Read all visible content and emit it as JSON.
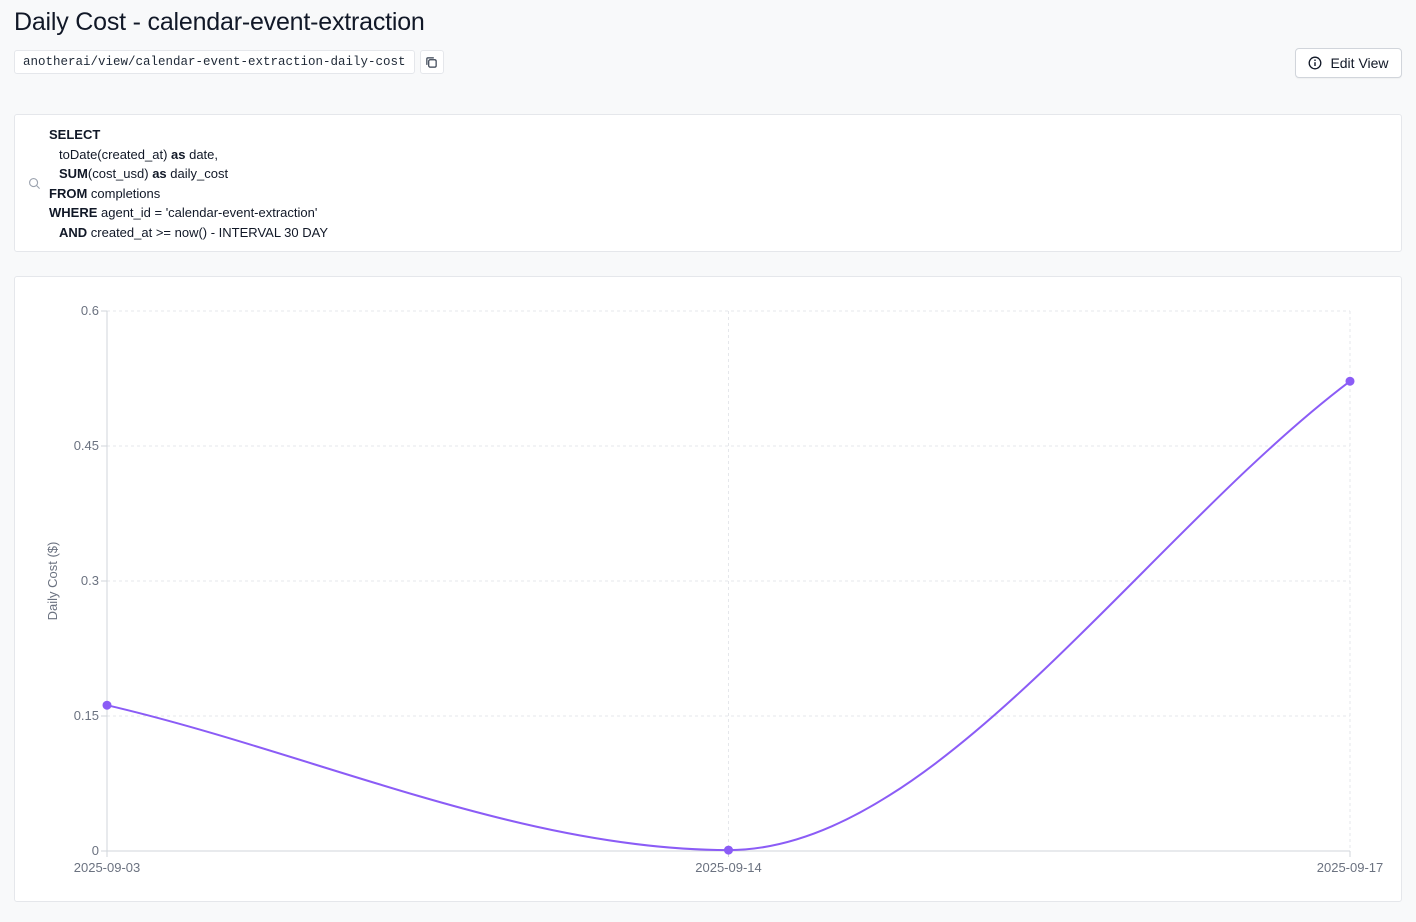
{
  "header": {
    "title": "Daily Cost - calendar-event-extraction",
    "view_url": "anotherai/view/calendar-event-extraction-daily-cost",
    "edit_label": "Edit View"
  },
  "icons": {
    "copy": "copy-icon",
    "info": "info-icon",
    "search": "search-icon"
  },
  "query": {
    "lines": [
      {
        "kw": "SELECT",
        "rest": ""
      },
      {
        "kw": "",
        "rest": "toDate(created_at) ",
        "kw2": "as",
        "rest2": " date,",
        "indent": true
      },
      {
        "kw": "SUM",
        "rest": "(cost_usd) ",
        "kw2": "as",
        "rest2": " daily_cost",
        "indent": true
      },
      {
        "kw": "FROM",
        "rest": " completions"
      },
      {
        "kw": "WHERE",
        "rest": " agent_id = 'calendar-event-extraction'"
      },
      {
        "kw": "AND",
        "rest": " created_at >= now() - INTERVAL 30 DAY",
        "indent": true
      }
    ]
  },
  "chart_data": {
    "type": "line",
    "categories": [
      "2025-09-03",
      "2025-09-14",
      "2025-09-17"
    ],
    "series": [
      {
        "values": [
          0.162,
          0.001,
          0.522
        ],
        "color": "#8b5cf6"
      }
    ],
    "xlabel": "",
    "ylabel": "Daily Cost ($)",
    "ylim": [
      0,
      0.6
    ],
    "yticks": [
      "0",
      "0.15",
      "0.3",
      "0.45",
      "0.6"
    ],
    "ytick_values": [
      0,
      0.15,
      0.3,
      0.45,
      0.6
    ],
    "grid": true
  }
}
